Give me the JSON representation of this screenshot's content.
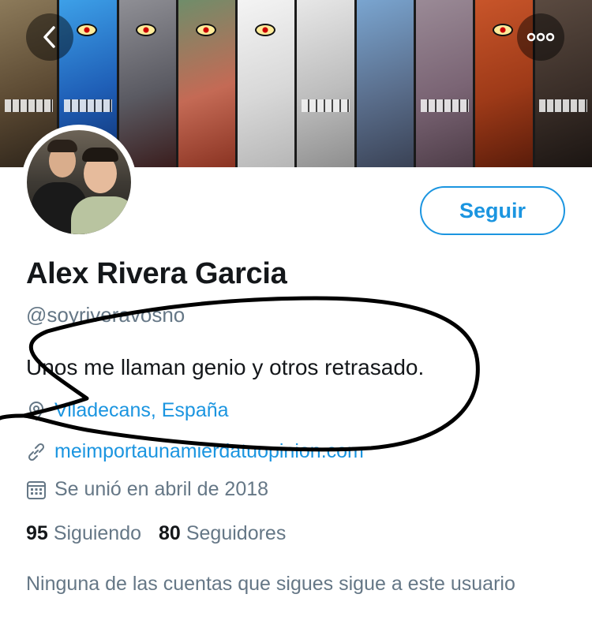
{
  "header": {
    "back_icon": "chevron-left-icon",
    "more_icon": "more-horizontal-icon"
  },
  "profile": {
    "follow_label": "Seguir",
    "name": "Alex Rivera Garcia",
    "handle": "@soyriveravosno",
    "bio": "Unos me llaman genio y otros retrasado.",
    "location": "Viladecans, España",
    "url": "meimportaunamierdatuopinion.com",
    "joined": "Se unió en abril de 2018",
    "following_count": "95",
    "following_label": "Siguiendo",
    "followers_count": "80",
    "followers_label": "Seguidores",
    "mutuals_note": "Ninguna de las cuentas que sigues sigue a este usuario"
  },
  "icons": {
    "location": "location-pin-icon",
    "link": "link-icon",
    "calendar": "calendar-icon"
  },
  "colors": {
    "accent": "#1b95e0",
    "text": "#14171a",
    "muted": "#657786"
  }
}
